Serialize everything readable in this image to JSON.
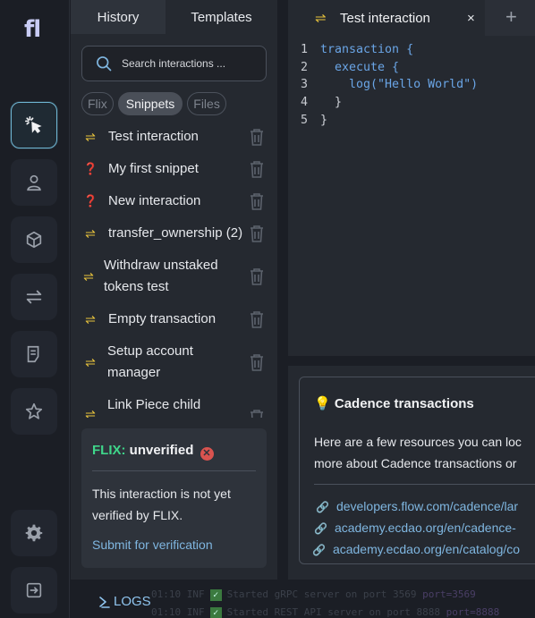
{
  "app": {
    "logo": "fl"
  },
  "rail": {
    "items": [
      {
        "name": "interactions",
        "icon": "cursor-click-icon",
        "active": true
      },
      {
        "name": "accounts",
        "icon": "user-icon"
      },
      {
        "name": "packages",
        "icon": "cube-icon"
      },
      {
        "name": "transactions",
        "icon": "arrows-swap-icon"
      },
      {
        "name": "documents",
        "icon": "document-icon"
      },
      {
        "name": "favorites",
        "icon": "star-icon"
      }
    ],
    "bottom": [
      {
        "name": "settings",
        "icon": "gear-icon"
      },
      {
        "name": "logout",
        "icon": "logout-icon"
      }
    ]
  },
  "sidebar": {
    "tabs": [
      {
        "label": "History",
        "active": true
      },
      {
        "label": "Templates",
        "active": false
      }
    ],
    "search": {
      "placeholder": "Search interactions ..."
    },
    "filters": [
      {
        "label": "Flix",
        "active": false
      },
      {
        "label": "Snippets",
        "active": true
      },
      {
        "label": "Files",
        "active": false
      }
    ],
    "items": [
      {
        "label": "Test interaction",
        "type": "transaction"
      },
      {
        "label": "My first snippet",
        "type": "unknown"
      },
      {
        "label": "New interaction",
        "type": "unknown"
      },
      {
        "label": "transfer_ownership (2)",
        "type": "transaction"
      },
      {
        "label": "Withdraw unstaked tokens test",
        "type": "transaction"
      },
      {
        "label": "Empty transaction",
        "type": "transaction"
      },
      {
        "label": "Setup account manager",
        "type": "transaction"
      },
      {
        "label": "Link Piece child",
        "type": "transaction"
      }
    ],
    "flix": {
      "label": "FLIX:",
      "status": "unverified",
      "body": "This interaction is not yet verified by FLIX.",
      "action": "Submit for verification"
    }
  },
  "editor": {
    "tab": {
      "title": "Test interaction",
      "close": "×"
    },
    "add_tab": "+",
    "lines": [
      {
        "n": "1",
        "t": "transaction {"
      },
      {
        "n": "2",
        "t": "  execute {"
      },
      {
        "n": "3",
        "t": "    log(\"Hello World\")"
      },
      {
        "n": "4",
        "t": "  }"
      },
      {
        "n": "5",
        "t": "}"
      }
    ]
  },
  "resources": {
    "title": "Cadence transactions",
    "text_line1": "Here are a few resources you can loc",
    "text_line2": "more about Cadence transactions or",
    "links": [
      "developers.flow.com/cadence/lar",
      "academy.ecdao.org/en/cadence-",
      "academy.ecdao.org/en/catalog/co"
    ]
  },
  "logs": {
    "label": "LOGS",
    "lines": [
      {
        "prefix": "01:10 INF",
        "text": "Started gRPC server on port 3569",
        "suffix": "port=3569"
      },
      {
        "prefix": "01:10 INF",
        "text": "Started REST API server on port 8888",
        "suffix": "port=8888"
      }
    ]
  },
  "colors": {
    "accent_link": "#7fb6e0",
    "flix_green": "#3fd68a",
    "swap_yellow": "#e7c23c",
    "error_red": "#d9534f"
  }
}
